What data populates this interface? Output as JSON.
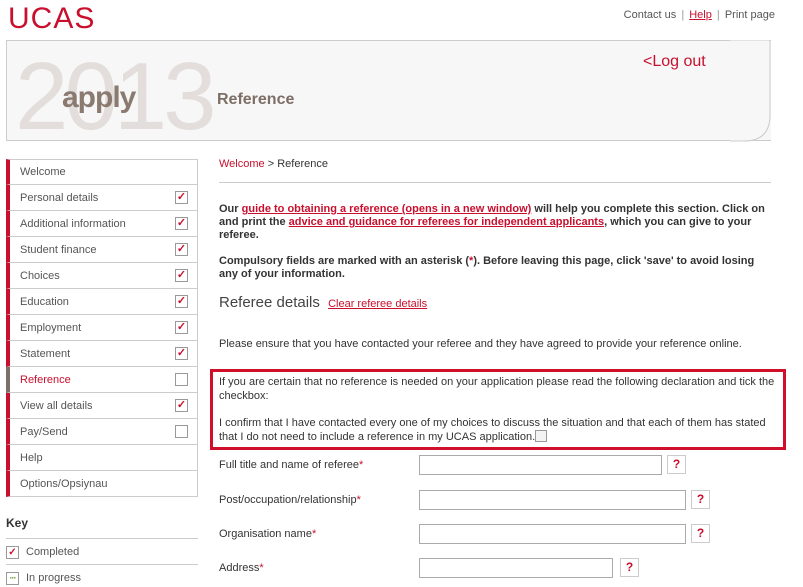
{
  "header": {
    "logo": "UCAS",
    "links": {
      "contact": "Contact us",
      "help": "Help",
      "print": "Print page",
      "sep": "|"
    },
    "year": "2013",
    "apply": "apply",
    "title": "Reference",
    "logout": "<Log out"
  },
  "nav": {
    "items": [
      {
        "label": "Welcome",
        "check": "none"
      },
      {
        "label": "Personal details",
        "check": "done"
      },
      {
        "label": "Additional information",
        "check": "done"
      },
      {
        "label": "Student finance",
        "check": "done"
      },
      {
        "label": "Choices",
        "check": "done"
      },
      {
        "label": "Education",
        "check": "done"
      },
      {
        "label": "Employment",
        "check": "done"
      },
      {
        "label": "Statement",
        "check": "done"
      },
      {
        "label": "Reference",
        "check": "empty",
        "current": true
      },
      {
        "label": "View all details",
        "check": "done"
      },
      {
        "label": "Pay/Send",
        "check": "empty"
      },
      {
        "label": "Help",
        "check": "none"
      },
      {
        "label": "Options/Opsiynau",
        "check": "none"
      }
    ]
  },
  "key": {
    "title": "Key",
    "completed": "Completed",
    "in_progress": "In progress"
  },
  "breadcrumb": {
    "home": "Welcome",
    "sep": ">",
    "current": "Reference"
  },
  "intro": {
    "p1_a": "Our ",
    "p1_link1": "guide to obtaining a reference (opens in a new window)",
    "p1_b": " will help you complete this section. Click on and print the ",
    "p1_link2": "advice and guidance for referees for independent applicants",
    "p1_c": ", which you can give to your referee.",
    "p2_a": "Compulsory fields are marked with an asterisk (",
    "p2_ast": "*",
    "p2_b": "). Before leaving this page, click 'save' to avoid losing any of your information."
  },
  "section": {
    "title": "Referee details",
    "clear": "Clear referee details",
    "ensure": "Please ensure that you have contacted your referee and they have agreed to provide your reference online."
  },
  "declaration": {
    "p1": "If you are certain that no reference is needed on your application please read the following declaration and tick the checkbox:",
    "p2": "I confirm that I have contacted every one of my choices to discuss the situation and that each of them has stated that I do not need to include a reference in my UCAS application."
  },
  "form": {
    "fields": [
      {
        "label": "Full title and name of referee",
        "ast": "*",
        "q": "?"
      },
      {
        "label": "Post/occupation/relationship",
        "ast": "*",
        "q": "?"
      },
      {
        "label": "Organisation name",
        "ast": "*",
        "q": "?"
      },
      {
        "label": "Address",
        "ast": "*",
        "q": "?"
      }
    ]
  },
  "colors": {
    "accent": "#c8102e",
    "heading": "#7d6f66"
  }
}
